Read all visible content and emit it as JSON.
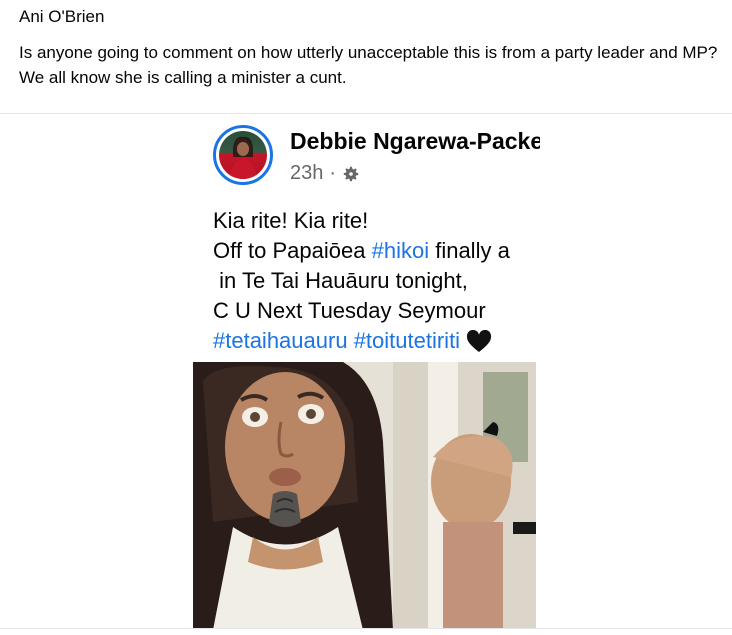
{
  "post": {
    "author": "Ani O'Brien",
    "text": "Is anyone going to comment on how utterly unacceptable this is from a party leader and MP? We all know she is calling a minister a cunt."
  },
  "embed": {
    "name": "Debbie Ngarewa-Packer",
    "time": "23h",
    "dot": "·",
    "line1": "Kia rite! Kia rite!",
    "line2_pre": "Off to Papaiōea ",
    "line2_tag": "#hikoi",
    "line2_post": " finally a",
    "line3": " in Te Tai Hauāuru tonight,",
    "line4": "C U Next Tuesday Seymour",
    "line5_tag1": "#tetaihauauru",
    "line5_tag2": "#toitutetiriti",
    "colors": {
      "link": "#1b74e4",
      "meta": "#65676b"
    }
  }
}
